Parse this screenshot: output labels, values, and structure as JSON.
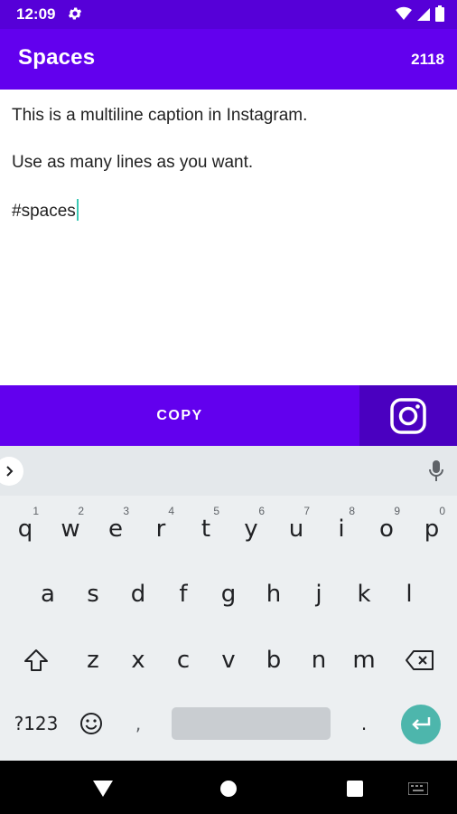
{
  "status_bar": {
    "time": "12:09"
  },
  "app_bar": {
    "title": "Spaces",
    "char_count": "2118"
  },
  "editor": {
    "lines": [
      "This is a multiline caption in Instagram.",
      "Use as many lines as you want.",
      "#spaces"
    ]
  },
  "actions": {
    "copy_label": "COPY"
  },
  "keyboard": {
    "row1": [
      {
        "key": "q",
        "hint": "1"
      },
      {
        "key": "w",
        "hint": "2"
      },
      {
        "key": "e",
        "hint": "3"
      },
      {
        "key": "r",
        "hint": "4"
      },
      {
        "key": "t",
        "hint": "5"
      },
      {
        "key": "y",
        "hint": "6"
      },
      {
        "key": "u",
        "hint": "7"
      },
      {
        "key": "i",
        "hint": "8"
      },
      {
        "key": "o",
        "hint": "9"
      },
      {
        "key": "p",
        "hint": "0"
      }
    ],
    "row2": [
      "a",
      "s",
      "d",
      "f",
      "g",
      "h",
      "j",
      "k",
      "l"
    ],
    "row3": [
      "z",
      "x",
      "c",
      "v",
      "b",
      "n",
      "m"
    ],
    "symbols_label": "?123",
    "period_label": "."
  },
  "colors": {
    "primary": "#6200ee",
    "primary_dark": "#5600d8",
    "instagram_bg": "#4a00c0",
    "accent": "#4db6ac"
  }
}
